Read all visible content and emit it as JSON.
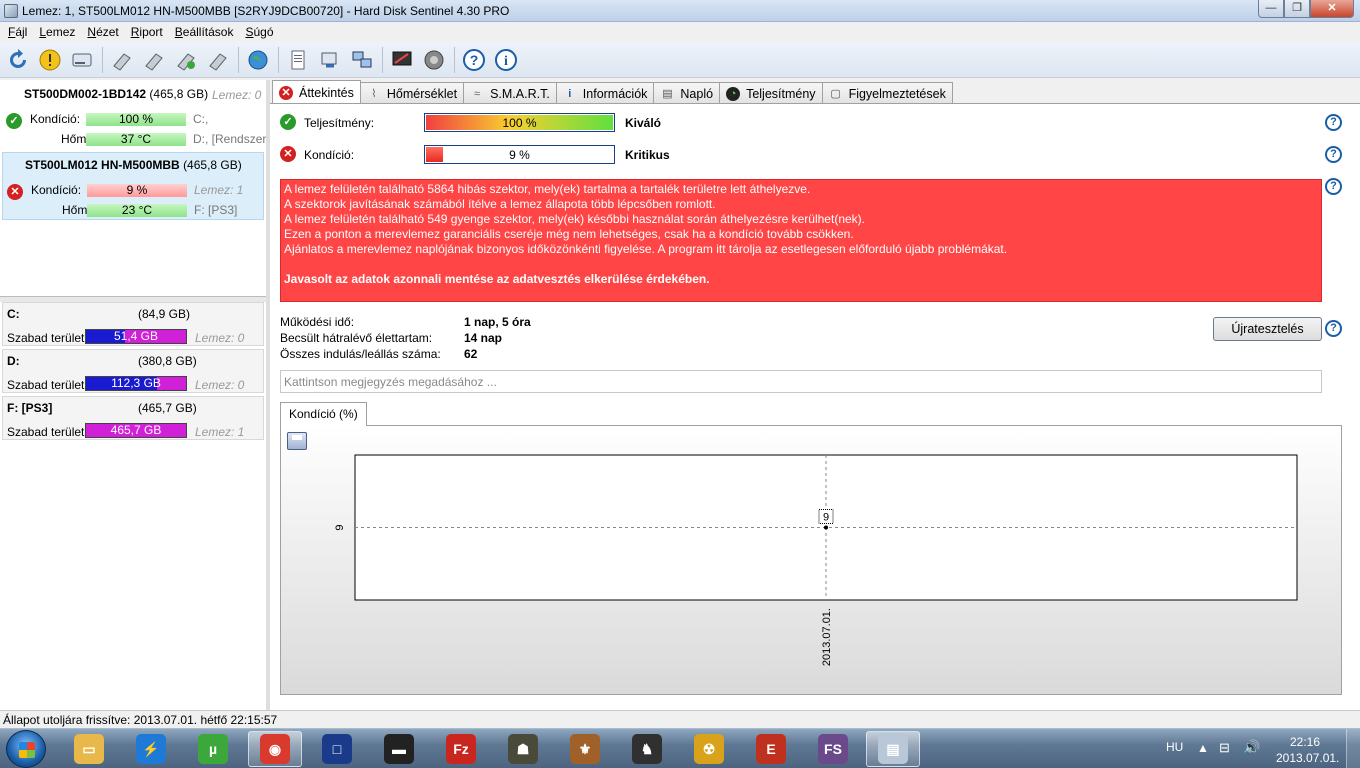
{
  "window": {
    "title": "Lemez: 1, ST500LM012 HN-M500MBB [S2RYJ9DCB00720]  -  Hard Disk Sentinel 4.30 PRO",
    "min": "—",
    "max": "❐",
    "close": "✕"
  },
  "menu": [
    {
      "u": "F",
      "rest": "ájl"
    },
    {
      "u": "L",
      "rest": "emez"
    },
    {
      "u": "N",
      "rest": "ézet"
    },
    {
      "u": "R",
      "rest": "iport"
    },
    {
      "u": "B",
      "rest": "eállítások"
    },
    {
      "u": "S",
      "rest": "úgó"
    }
  ],
  "toolbar_icons": [
    "refresh-icon",
    "alert-icon",
    "disk-icon",
    "drive-info-icon",
    "drive-test-icon",
    "drive-ok-icon",
    "drive-tool-icon",
    "globe-icon",
    "report-icon",
    "sync-icon",
    "network-icon",
    "monitor-icon",
    "sound-icon",
    "help-icon",
    "info-icon"
  ],
  "disks": [
    {
      "name": "ST500DM002-1BD142",
      "size": "(465,8 GB)",
      "lemez": "Lemez: 0",
      "kond_label": "Kondíció:",
      "kond_value": "100 %",
      "hom_label": "Hőm.:",
      "hom_value": "37 °C",
      "side1": "C:,",
      "side2": "D:, [Rendszer"
    },
    {
      "name": "ST500LM012 HN-M500MBB",
      "size": "(465,8 GB)",
      "kond_label": "Kondíció:",
      "kond_value": "9 %",
      "hom_label": "Hőm.:",
      "hom_value": "23 °C",
      "side1": "Lemez: 1",
      "side2": "F: [PS3]"
    }
  ],
  "volumes": [
    {
      "name": "C:",
      "size": "(84,9 GB)",
      "free_label": "Szabad terület",
      "free": "51,4 GB",
      "lemez": "Lemez: 0",
      "color": "#d020d8",
      "fill": 0.61
    },
    {
      "name": "D:",
      "size": "(380,8 GB)",
      "free_label": "Szabad terület",
      "free": "112,3 GB",
      "lemez": "Lemez: 0",
      "color": "#d020d8",
      "fill": 0.29
    },
    {
      "name": "F: [PS3]",
      "size": "(465,7 GB)",
      "free_label": "Szabad terület",
      "free": "465,7 GB",
      "lemez": "Lemez: 1",
      "color": "#d020d8",
      "fill": 1.0
    }
  ],
  "tabs": [
    {
      "label": "Áttekintés",
      "icon": "✕",
      "name": "overview-tab-icon"
    },
    {
      "label": "Hőmérséklet",
      "icon": "🌡",
      "name": "thermometer-icon"
    },
    {
      "label": "S.M.A.R.T.",
      "icon": "≈",
      "name": "smart-icon"
    },
    {
      "label": "Információk",
      "icon": "i",
      "name": "information-icon"
    },
    {
      "label": "Napló",
      "icon": "▤",
      "name": "log-icon"
    },
    {
      "label": "Teljesítmény",
      "icon": "◉",
      "name": "performance-icon"
    },
    {
      "label": "Figyelmeztetések",
      "icon": "▢",
      "name": "warnings-icon"
    }
  ],
  "overview": {
    "perf_label": "Teljesítmény:",
    "perf_value": "100 %",
    "perf_fraction": 1.0,
    "perf_rating": "Kiváló",
    "cond_label": "Kondíció:",
    "cond_value": "9 %",
    "cond_fraction": 0.09,
    "cond_rating": "Kritikus",
    "alert_lines": [
      "A lemez felületén található 5864 hibás szektor, mely(ek) tartalma a tartalék területre lett áthelyezve.",
      "A szektorok javításának számából ítélve a lemez állapota több lépcsőben romlott.",
      "A lemez felületén található 549 gyenge szektor, mely(ek) későbbi használat során áthelyezésre kerülhet(nek).",
      "Ezen a ponton a merevlemez garanciális cseréje még nem lehetséges, csak ha a kondíció tovább csökken.",
      "Ajánlatos a merevlemez naplójának bizonyos időközönkénti figyelése. A program itt tárolja az esetlegesen előforduló újabb problémákat."
    ],
    "alert_strong": "Javasolt az adatok azonnali mentése az adatvesztés elkerülése érdekében.",
    "uptime_label": "Működési idő:",
    "uptime_value": "1 nap, 5 óra",
    "remaining_label": "Becsült hátralévő élettartam:",
    "remaining_value": "14 nap",
    "starts_label": "Összes indulás/leállás száma:",
    "starts_value": "62",
    "retest_button": "Újratesztelés",
    "note_placeholder": "Kattintson megjegyzés megadásához ...",
    "chart_tab": "Kondíció  (%)",
    "help": "?"
  },
  "chart_data": {
    "type": "line",
    "x": [
      "2013.07.01."
    ],
    "series": [
      {
        "values": [
          9
        ]
      }
    ],
    "yticks": [
      "9"
    ],
    "xticks": [
      "2013.07.01."
    ],
    "point_labels": [
      "9"
    ],
    "grid": true
  },
  "status": "Állapot utoljára frissítve: 2013.07.01. hétfő 22:15:57",
  "taskbar": {
    "apps": [
      {
        "name": "taskbar-explorer-icon",
        "color": "#e8b84a",
        "glyph": "▭"
      },
      {
        "name": "taskbar-lightning-icon",
        "color": "#1e7ad6",
        "glyph": "⚡"
      },
      {
        "name": "taskbar-utorrent-icon",
        "color": "#3ca83c",
        "glyph": "µ"
      },
      {
        "name": "taskbar-chrome-icon",
        "color": "#d93a2e",
        "glyph": "◉"
      },
      {
        "name": "taskbar-app-square-icon",
        "color": "#1a3a8a",
        "glyph": "□"
      },
      {
        "name": "taskbar-ps3-icon",
        "color": "#222222",
        "glyph": "▬"
      },
      {
        "name": "taskbar-filezilla-icon",
        "color": "#c8261e",
        "glyph": "Fz"
      },
      {
        "name": "taskbar-game-icon",
        "color": "#4a4a3a",
        "glyph": "☗"
      },
      {
        "name": "taskbar-rune-icon",
        "color": "#a0602a",
        "glyph": "⚜"
      },
      {
        "name": "taskbar-assassin-icon",
        "color": "#303030",
        "glyph": "♞"
      },
      {
        "name": "taskbar-radiation-icon",
        "color": "#d8a21a",
        "glyph": "☢"
      },
      {
        "name": "taskbar-evolution-icon",
        "color": "#c0301e",
        "glyph": "E"
      },
      {
        "name": "taskbar-fs-icon",
        "color": "#6a4a8a",
        "glyph": "FS"
      },
      {
        "name": "taskbar-hds-icon",
        "color": "#b8c8d8",
        "glyph": "▤"
      }
    ],
    "lang": "HU",
    "time": "22:16",
    "date": "2013.07.01."
  }
}
